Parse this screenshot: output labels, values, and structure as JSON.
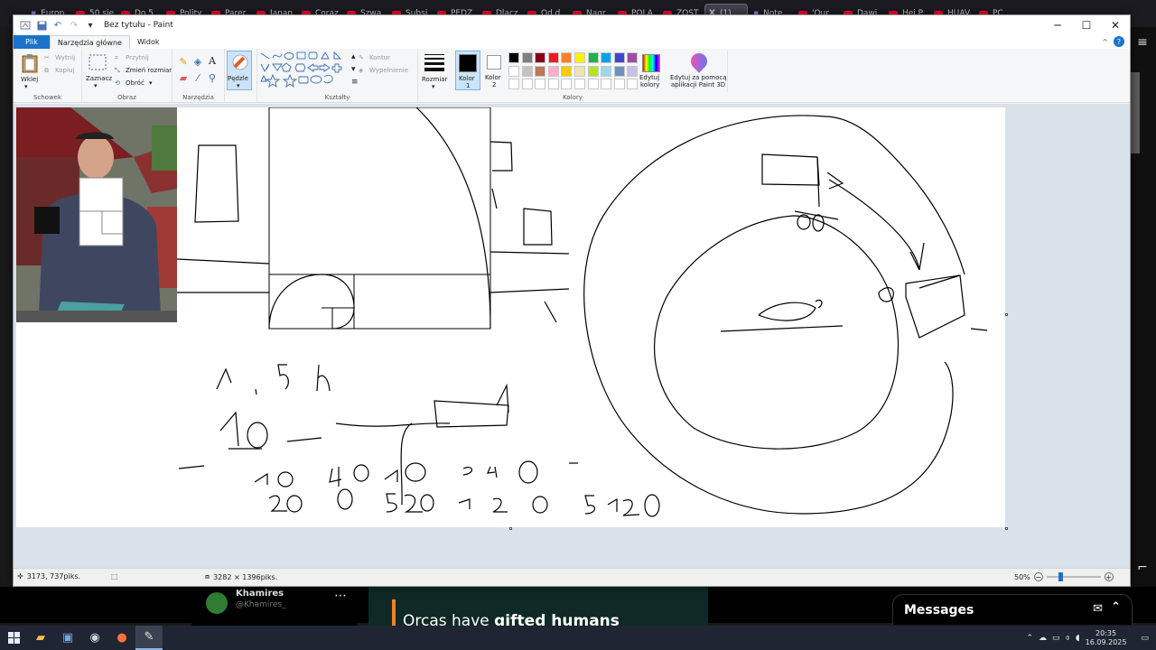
{
  "browser": {
    "tabs": [
      {
        "label": "Europ",
        "kind": "plain"
      },
      {
        "label": "50 sie",
        "kind": "yt"
      },
      {
        "label": "Do 5",
        "kind": "yt"
      },
      {
        "label": "Polity",
        "kind": "yt"
      },
      {
        "label": "Parer",
        "kind": "yt"
      },
      {
        "label": "Japan",
        "kind": "yt"
      },
      {
        "label": "Coraz",
        "kind": "yt"
      },
      {
        "label": "Szwa",
        "kind": "yt"
      },
      {
        "label": "Subsi",
        "kind": "yt"
      },
      {
        "label": "PEDZ",
        "kind": "yt"
      },
      {
        "label": "Dlacz",
        "kind": "yt"
      },
      {
        "label": "Od d",
        "kind": "yt"
      },
      {
        "label": "Nagr",
        "kind": "yt"
      },
      {
        "label": "POLA",
        "kind": "yt"
      },
      {
        "label": "ZOST",
        "kind": "yt"
      },
      {
        "label": "(1)",
        "kind": "x",
        "active": true
      },
      {
        "label": "Note",
        "kind": "plain"
      },
      {
        "label": "'Our",
        "kind": "yt"
      },
      {
        "label": "Dawi",
        "kind": "yt"
      },
      {
        "label": "Hej P",
        "kind": "yt"
      },
      {
        "label": "HUAV",
        "kind": "yt"
      },
      {
        "label": "PC",
        "kind": "yt"
      }
    ]
  },
  "window": {
    "title": "Bez tytułu - Paint",
    "minimize": "─",
    "maximize": "☐",
    "close": "✕"
  },
  "menu": {
    "file": "Plik",
    "home": "Narzędzia główne",
    "view": "Widok",
    "collapse": "^",
    "help": "?"
  },
  "ribbon": {
    "clipboard": {
      "label": "Schowek",
      "paste": "Wklej",
      "cut": "Wytnij",
      "copy": "Kopiuj"
    },
    "image": {
      "label": "Obraz",
      "select": "Zaznacz",
      "crop": "Przytnij",
      "resize": "Zmień rozmiar",
      "rotate": "Obróć"
    },
    "tools": {
      "label": "Narzędzia"
    },
    "brushes": {
      "label": "Pędzle"
    },
    "shapes": {
      "label": "Kształty",
      "outline": "Kontur",
      "fill": "Wypełnienie"
    },
    "size": {
      "label": "Rozmiar"
    },
    "color1": {
      "label": "Kolor",
      "num": "1"
    },
    "color2": {
      "label": "Kolor",
      "num": "2"
    },
    "colors": {
      "label": "Kolory"
    },
    "edit_colors": {
      "line1": "Edytuj",
      "line2": "kolory"
    },
    "paint3d": {
      "line1": "Edytuj za pomocą",
      "line2": "aplikacji Paint 3D"
    },
    "palette": [
      "#000000",
      "#7f7f7f",
      "#880015",
      "#ed1c24",
      "#ff7f27",
      "#fff200",
      "#22b14c",
      "#00a2e8",
      "#3f48cc",
      "#a349a4",
      "#ffffff",
      "#c3c3c3",
      "#b97a57",
      "#ffaec9",
      "#ffc90e",
      "#efe4b0",
      "#b5e61d",
      "#99d9ea",
      "#7092be",
      "#c8bfe7"
    ]
  },
  "status": {
    "cursor": "3173, 737piks.",
    "size": "3282 × 1396piks.",
    "zoom": "50%"
  },
  "background": {
    "user_name": "Khamires",
    "user_handle": "@Khamires_",
    "tweet_text_1": "Orcas have ",
    "tweet_text_2": "gifted humans",
    "messages": "Messages"
  },
  "taskbar": {
    "time": "20:35",
    "date": "16.09.2025"
  }
}
